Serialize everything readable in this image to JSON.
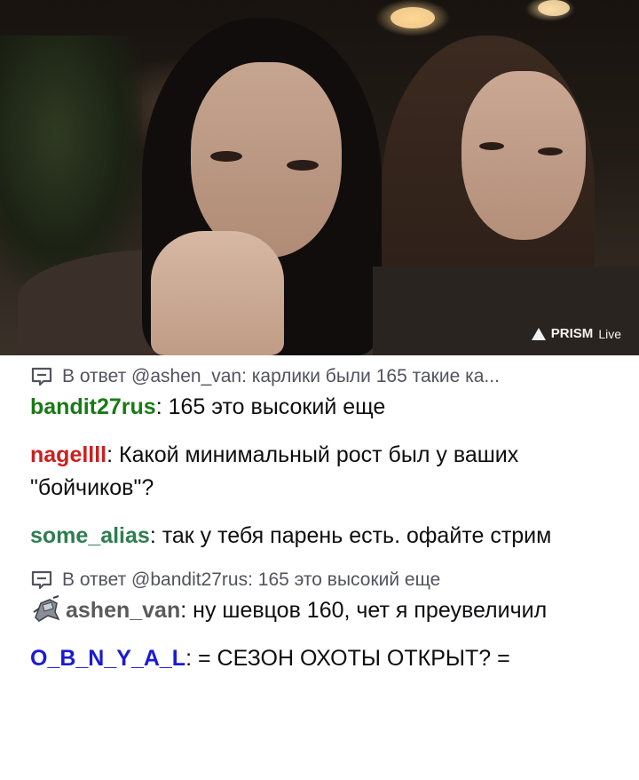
{
  "stream": {
    "watermark_brand": "PRISM",
    "watermark_suffix": "Live"
  },
  "chat": {
    "messages": [
      {
        "reply_to": "В ответ @ashen_van: карлики были 165 такие ка...",
        "username": "bandit27rus",
        "username_color": "#1a7a16",
        "text": ": 165 это высокий еще"
      },
      {
        "username": "nagellll",
        "username_color": "#cc1f1f",
        "text": ": Какой минимальный рост был у ваших \"бойчиков\"?"
      },
      {
        "username": "some_alias",
        "username_color": "#2e7d4f",
        "text": ": так у тебя парень есть. офайте стрим"
      },
      {
        "reply_to": "В ответ @bandit27rus: 165 это высокий еще",
        "username": "ashen_van",
        "username_color": "#5a5a5a",
        "badge": "robot-knight-badge",
        "text": ": ну шевцов 160, чет я преувеличил"
      },
      {
        "username": "O_B_N_Y_A_L",
        "username_color": "#1a1ad6",
        "text": ": = СЕЗОН ОХОТЫ ОТКРЫТ? ="
      }
    ]
  }
}
